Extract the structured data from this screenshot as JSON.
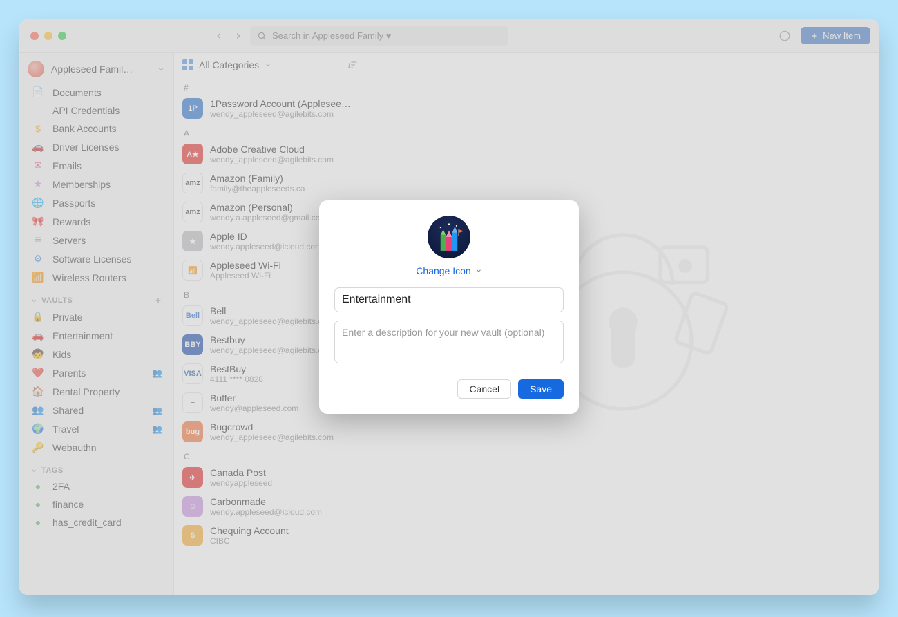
{
  "toolbar": {
    "search_placeholder": "Search in Appleseed Family ♥",
    "new_item_label": "New Item"
  },
  "sidebar": {
    "vault_selector": "Appleseed Famil…",
    "categories": [
      {
        "icon": "📄",
        "color": "#4a8fe7",
        "label": "Documents"
      },
      {
        "icon": "</>",
        "color": "#4a8fe7",
        "label": "API Credentials"
      },
      {
        "icon": "$",
        "color": "#f5a623",
        "label": "Bank Accounts"
      },
      {
        "icon": "🚗",
        "color": "#e86",
        "label": "Driver Licenses"
      },
      {
        "icon": "✉",
        "color": "#e24a6f",
        "label": "Emails"
      },
      {
        "icon": "★",
        "color": "#c78de0",
        "label": "Memberships"
      },
      {
        "icon": "🌐",
        "color": "#4a8fe7",
        "label": "Passports"
      },
      {
        "icon": "🎀",
        "color": "#f0a7b9",
        "label": "Rewards"
      },
      {
        "icon": "≣",
        "color": "#9aa0a6",
        "label": "Servers"
      },
      {
        "icon": "⚙",
        "color": "#4a8fe7",
        "label": "Software Licenses"
      },
      {
        "icon": "📶",
        "color": "#4a8fe7",
        "label": "Wireless Routers"
      }
    ],
    "vaults_header": "VAULTS",
    "vaults": [
      {
        "emoji": "🔒",
        "label": "Private",
        "shared": false
      },
      {
        "emoji": "🚗",
        "label": "Entertainment",
        "shared": false
      },
      {
        "emoji": "🧒",
        "label": "Kids",
        "shared": false
      },
      {
        "emoji": "❤️",
        "label": "Parents",
        "shared": true
      },
      {
        "emoji": "🏠",
        "label": "Rental Property",
        "shared": false
      },
      {
        "emoji": "👥",
        "label": "Shared",
        "shared": true
      },
      {
        "emoji": "🌍",
        "label": "Travel",
        "shared": true
      },
      {
        "emoji": "🔑",
        "label": "Webauthn",
        "shared": false
      }
    ],
    "tags_header": "TAGS",
    "tags": [
      {
        "color": "#57b368",
        "label": "2FA"
      },
      {
        "color": "#57b368",
        "label": "finance"
      },
      {
        "color": "#57b368",
        "label": "has_credit_card"
      }
    ]
  },
  "itemlist": {
    "categories_label": "All Categories",
    "groups": [
      {
        "letter": "#",
        "items": [
          {
            "bg": "#1a66c9",
            "icon": "1P",
            "title": "1Password Account (Applesee…",
            "sub": "wendy_appleseed@agilebits.com"
          }
        ]
      },
      {
        "letter": "A",
        "items": [
          {
            "bg": "#e1201c",
            "icon": "A★",
            "title": "Adobe Creative Cloud",
            "sub": "wendy_appleseed@agilebits.com"
          },
          {
            "bg": "#ffffff",
            "fg": "#333",
            "icon": "amz",
            "title": "Amazon (Family)",
            "sub": "family@theappleseeds.ca"
          },
          {
            "bg": "#ffffff",
            "fg": "#333",
            "icon": "amz",
            "title": "Amazon (Personal)",
            "sub": "wendy.a.appleseed@gmail.co"
          },
          {
            "bg": "#b9b9be",
            "icon": "★",
            "title": "Apple ID",
            "sub": "wendy.appleseed@icloud.cor"
          },
          {
            "bg": "#ffffff",
            "fg": "#4a8fe7",
            "icon": "📶",
            "title": "Appleseed Wi-Fi",
            "sub": "Appleseed Wi-Fi"
          }
        ]
      },
      {
        "letter": "B",
        "items": [
          {
            "bg": "#ffffff",
            "fg": "#1a66c9",
            "icon": "Bell",
            "title": "Bell",
            "sub": "wendy_appleseed@agilebits.c"
          },
          {
            "bg": "#0b3ea8",
            "icon": "BBY",
            "title": "Bestbuy",
            "sub": "wendy_appleseed@agilebits.c"
          },
          {
            "bg": "#ffffff",
            "fg": "#1a4fa0",
            "icon": "VISA",
            "title": "BestBuy",
            "sub": "4111 **** 0828"
          },
          {
            "bg": "#ffffff",
            "fg": "#333",
            "icon": "≡",
            "title": "Buffer",
            "sub": "wendy@appleseed.com"
          },
          {
            "bg": "#f26c2d",
            "icon": "bug",
            "title": "Bugcrowd",
            "sub": "wendy_appleseed@agilebits.com"
          }
        ]
      },
      {
        "letter": "C",
        "items": [
          {
            "bg": "#e31a1a",
            "icon": "✈",
            "title": "Canada Post",
            "sub": "wendyappleseed"
          },
          {
            "bg": "#c78de0",
            "icon": "☺",
            "title": "Carbonmade",
            "sub": "wendy.appleseed@icloud.com"
          },
          {
            "bg": "#f5a623",
            "icon": "$",
            "title": "Chequing Account",
            "sub": "CIBC"
          }
        ]
      }
    ]
  },
  "modal": {
    "change_icon_label": "Change Icon",
    "name_value": "Entertainment",
    "desc_placeholder": "Enter a description for your new vault (optional)",
    "cancel_label": "Cancel",
    "save_label": "Save"
  }
}
